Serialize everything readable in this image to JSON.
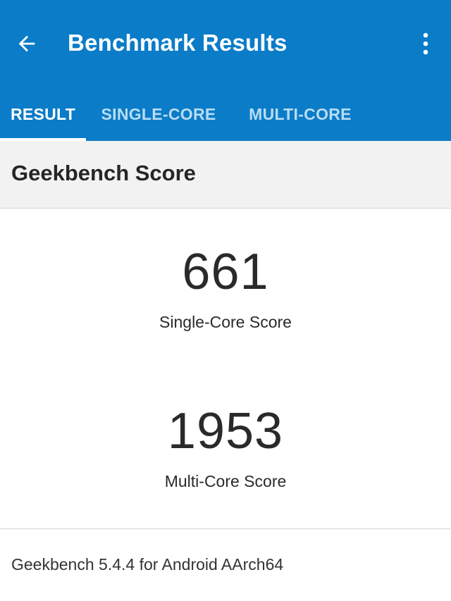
{
  "app_bar": {
    "title": "Benchmark Results",
    "back_icon": "arrow-left-icon",
    "menu_icon": "more-vert-icon",
    "color": "#0a7cc8"
  },
  "tabs": [
    {
      "label": "RESULT",
      "active": true
    },
    {
      "label": "SINGLE-CORE",
      "active": false
    },
    {
      "label": "MULTI-CORE",
      "active": false
    }
  ],
  "section": {
    "title": "Geekbench Score"
  },
  "scores": {
    "single_core": {
      "value": "661",
      "label": "Single-Core Score"
    },
    "multi_core": {
      "value": "1953",
      "label": "Multi-Core Score"
    }
  },
  "footer": {
    "version_text": "Geekbench 5.4.4 for Android AArch64"
  }
}
